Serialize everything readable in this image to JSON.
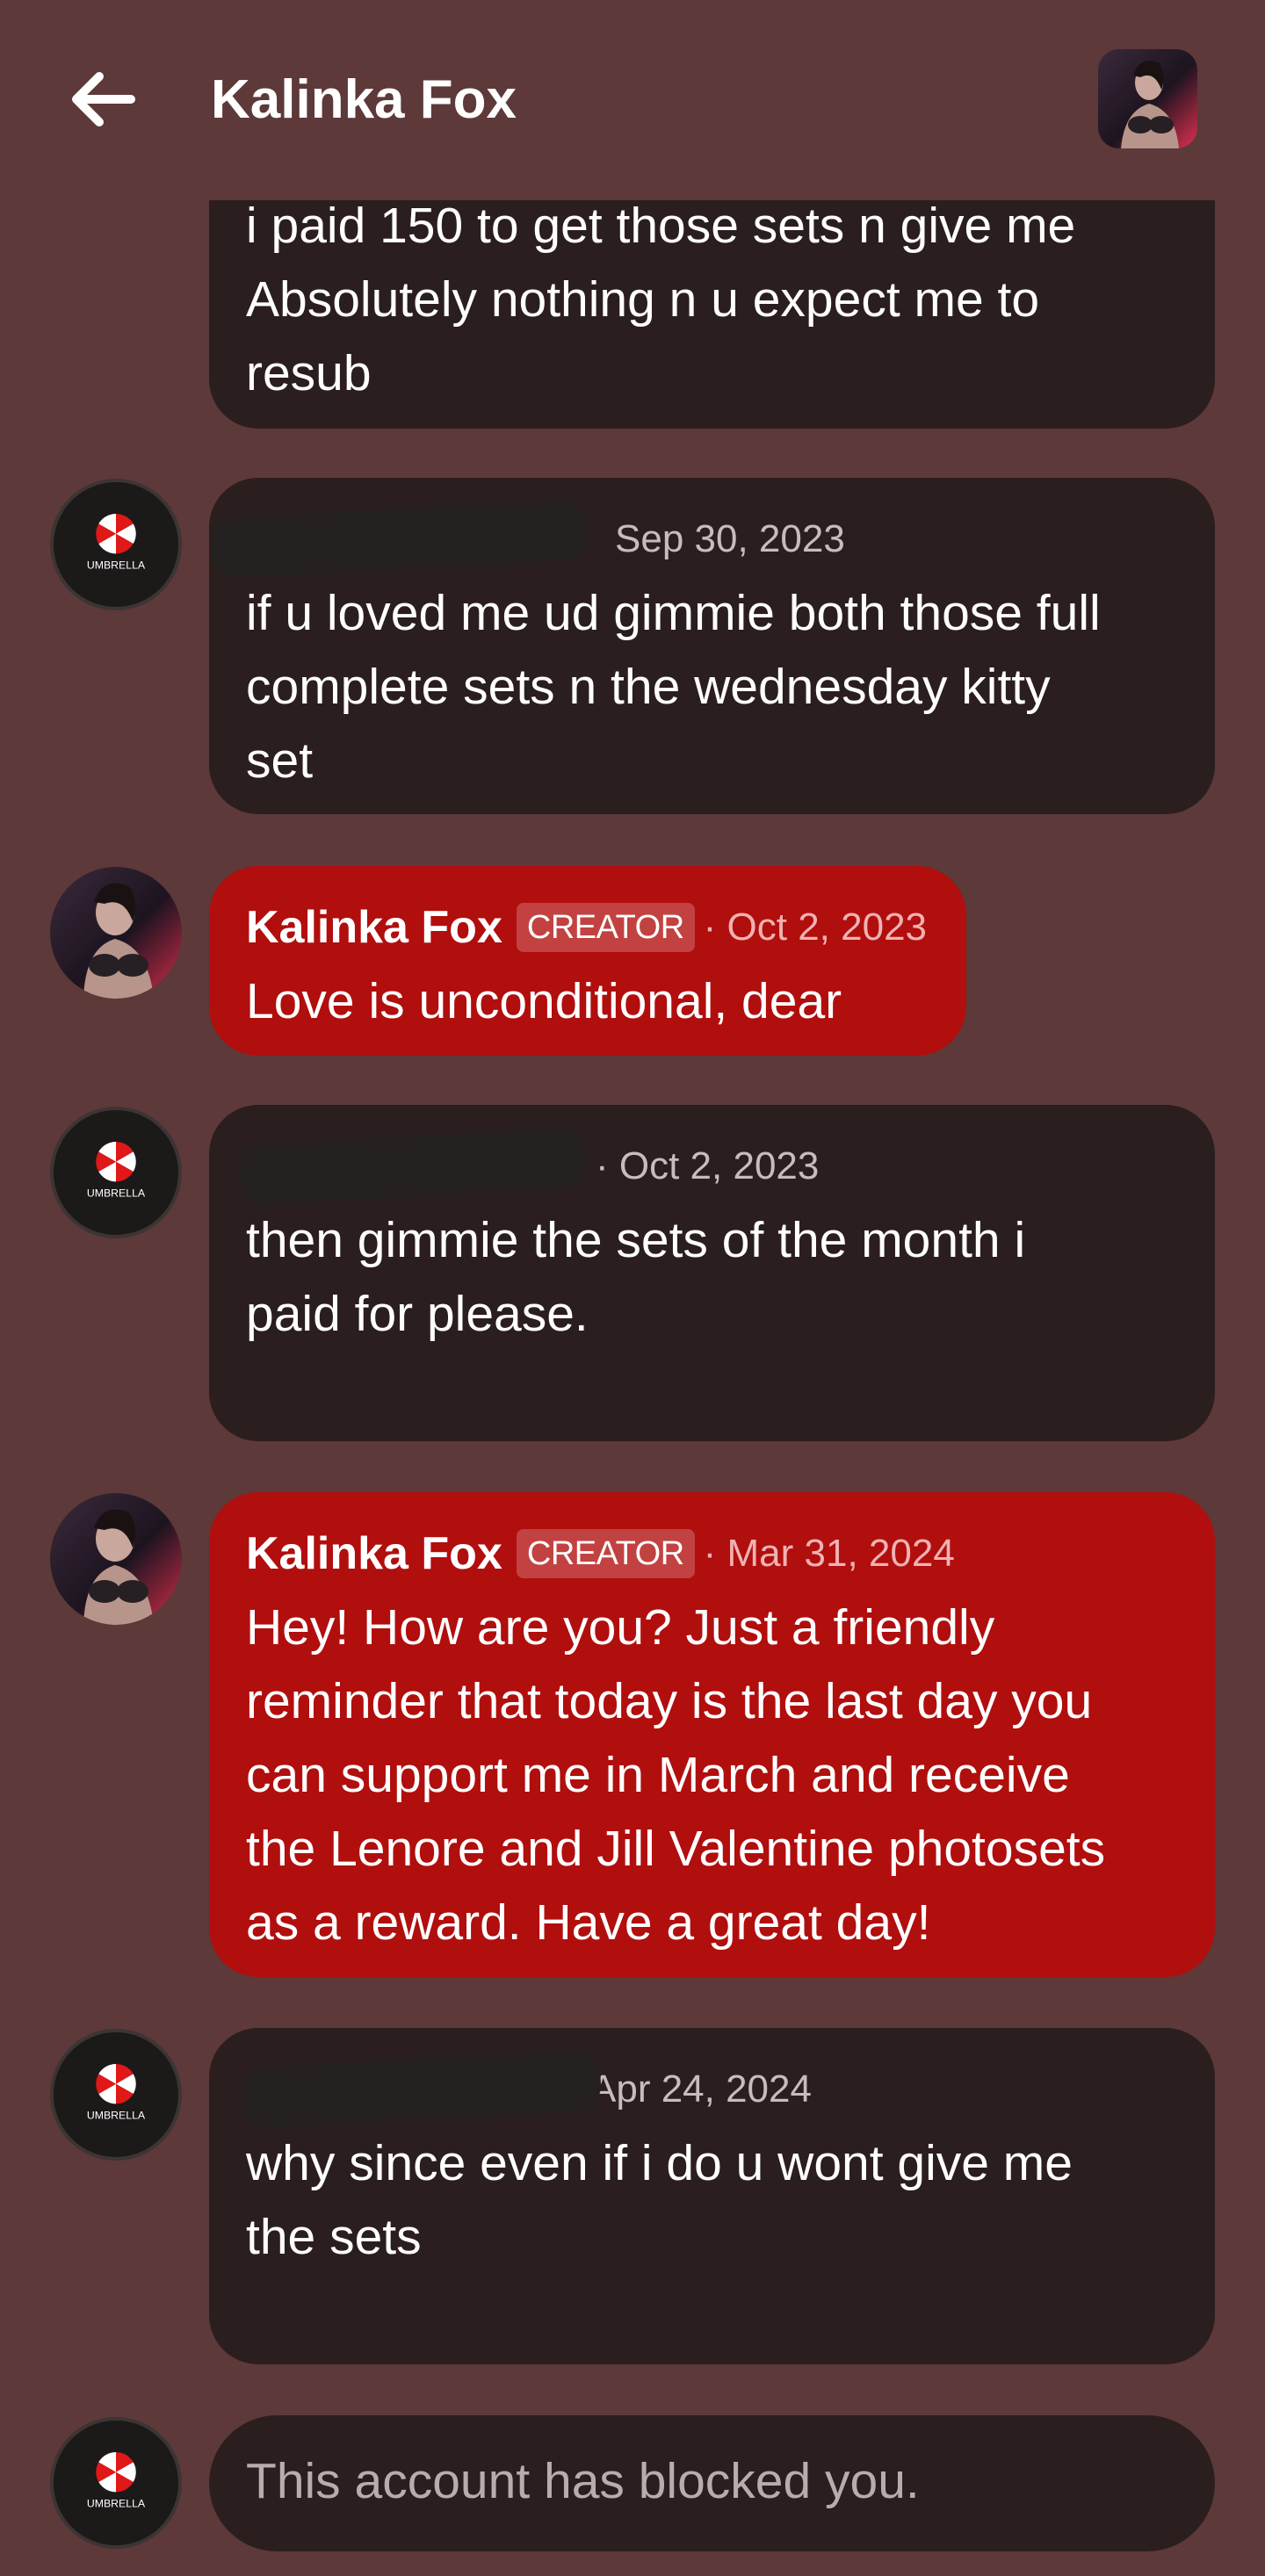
{
  "header": {
    "title": "Kalinka Fox",
    "back_icon": "arrow-left-icon",
    "avatar": "creator-profile-avatar"
  },
  "colors": {
    "background": "#5d3939",
    "bubble_dark": "#2b1e1e",
    "bubble_creator": "#b10e0e",
    "text": "#ffffff",
    "muted_text": "#c8bcbc"
  },
  "messages": [
    {
      "sender": "",
      "text": "i paid 150 to get those sets n give me\nAbsolutely nothing n u expect me to\nresub"
    },
    {
      "sender": "[redacted]",
      "date": "Sep 30, 2023",
      "text": "if u loved me ud gimmie both those full\ncomplete sets n the wednesday kitty\nset"
    },
    {
      "sender": "Kalinka Fox",
      "badge": "CREATOR",
      "date": "· Oct 2, 2023",
      "text": "Love is unconditional, dear"
    },
    {
      "sender": "[redacted]",
      "date": "· Oct 2, 2023",
      "text": "then gimmie the sets of the month i\npaid for please."
    },
    {
      "sender": "Kalinka Fox",
      "badge": "CREATOR",
      "date": "· Mar 31, 2024",
      "text": "Hey! How are you? Just a friendly\nreminder that today is the last day you\ncan support me in March and receive\nthe Lenore and Jill Valentine photosets\nas a reward. Have a great day!"
    },
    {
      "sender": "[redacted]",
      "date": "Apr 24, 2024",
      "text": "why since even if i do u wont give me\nthe sets"
    }
  ],
  "composer": {
    "blocked_text": "This account has blocked you."
  },
  "avatar_logo_text": "UMBRELLA"
}
